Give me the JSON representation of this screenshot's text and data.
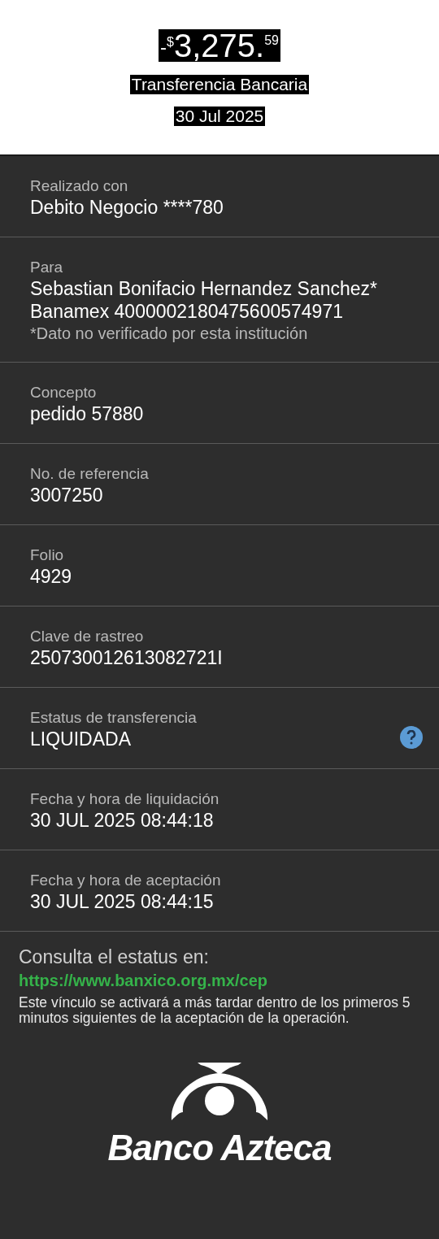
{
  "header": {
    "amount": {
      "sign": "-",
      "currency": "$",
      "whole": "3,275.",
      "cents": "59"
    },
    "type": "Transferencia Bancaria",
    "date": "30 Jul 2025"
  },
  "details": [
    {
      "label": "Realizado con",
      "values": [
        "Debito Negocio ****780"
      ],
      "help": false
    },
    {
      "label": "Para",
      "values": [
        "Sebastian Bonifacio Hernandez Sanchez*",
        "Banamex 4000002180475600574971"
      ],
      "note": "*Dato no verificado por esta institución",
      "help": false
    },
    {
      "label": "Concepto",
      "values": [
        "pedido 57880"
      ],
      "help": false
    },
    {
      "label": "No. de referencia",
      "values": [
        "3007250"
      ],
      "help": false
    },
    {
      "label": "Folio",
      "values": [
        "4929"
      ],
      "help": false
    },
    {
      "label": "Clave de rastreo",
      "values": [
        "250730012613082721I"
      ],
      "help": false
    },
    {
      "label": "Estatus de transferencia",
      "values": [
        "LIQUIDADA"
      ],
      "help": true
    },
    {
      "label": "Fecha y hora de liquidación",
      "values": [
        "30 JUL 2025 08:44:18"
      ],
      "help": false
    },
    {
      "label": "Fecha y hora de aceptación",
      "values": [
        "30 JUL 2025 08:44:15"
      ],
      "help": false
    }
  ],
  "footer": {
    "title": "Consulta el estatus en:",
    "link": "https://www.banxico.org.mx/cep",
    "text": "Este vínculo se activará a más tardar dentro de los primeros 5 minutos siguientes de la aceptación de la operación.",
    "brand": "Banco Azteca"
  }
}
